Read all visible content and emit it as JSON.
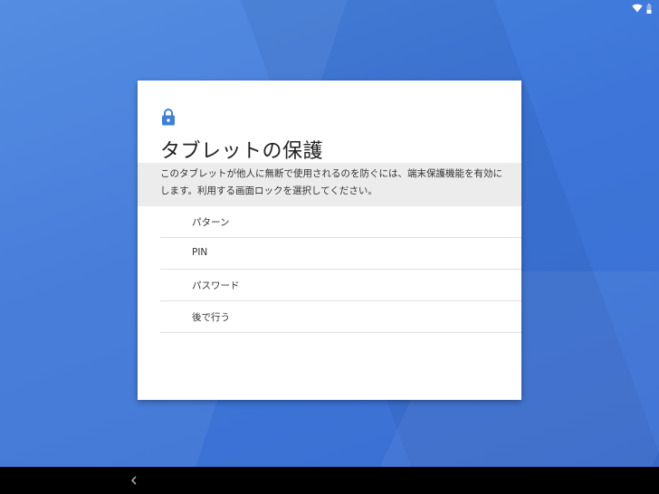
{
  "screen": {
    "title": "タブレットの保護",
    "description": "このタブレットが他人に無断で使用されるのを防ぐには、端末保護機能を有効にします。利用する画面ロックを選択してください。",
    "options": [
      {
        "label": "パターン"
      },
      {
        "label": "PIN"
      },
      {
        "label": "パスワード"
      },
      {
        "label": "後で行う"
      }
    ]
  },
  "icons": {
    "header": "lock-icon",
    "status_wifi": "wifi-icon",
    "status_battery": "battery-icon",
    "nav_back": "back-icon"
  },
  "colors": {
    "accent": "#3f7fd4",
    "wallpaper": "#3f78d6",
    "card": "#ffffff",
    "description_background": "#ececec",
    "navbar": "#000000"
  }
}
